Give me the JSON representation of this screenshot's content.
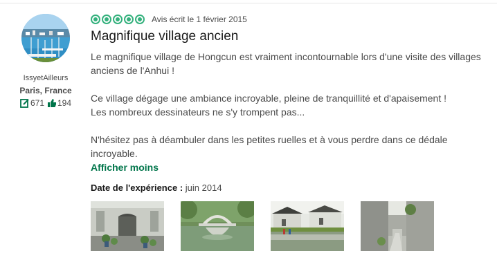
{
  "member": {
    "username": "IssyetAilleurs",
    "location": "Paris, France",
    "reviews_count": "671",
    "helpful_votes": "194",
    "review_icon": "review-count-icon",
    "helpful_icon": "thumbs-up-icon"
  },
  "review": {
    "rating": 5,
    "rating_max": 5,
    "date": "Avis écrit le 1 février 2015",
    "title": "Magnifique village ancien",
    "paragraphs": {
      "p1": "Le magnifique village de Hongcun est vraiment incontournable lors d'une visite des villages anciens de l'Anhui !",
      "p2a": "Ce village dégage une ambiance incroyable, pleine de tranquillité et d'apaisement !",
      "p2b": "Les nombreux dessinateurs ne s'y trompent pas...",
      "p3": "N'hésitez pas à déambuler dans les petites ruelles et à vous perdre dans ce dédale incroyable."
    },
    "show_less_label": "Afficher moins",
    "experience_label": "Date de l'expérience :",
    "experience_value": "juin 2014"
  },
  "colors": {
    "brand_green": "#34b17d",
    "link_green": "#00754a",
    "title": "#1a1a1a",
    "text": "#4a4a4a"
  }
}
